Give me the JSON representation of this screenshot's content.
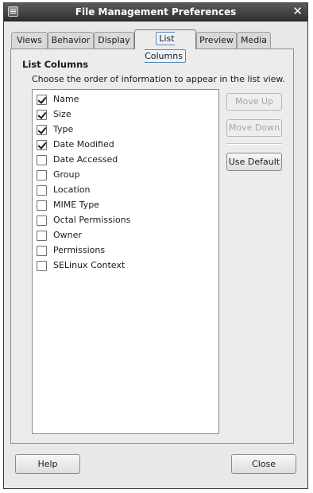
{
  "window": {
    "title": "File Management Preferences",
    "close_symbol": "✕"
  },
  "tabs": [
    {
      "label": "Views"
    },
    {
      "label": "Behavior"
    },
    {
      "label": "Display"
    },
    {
      "label": "List Columns",
      "active": true
    },
    {
      "label": "Preview"
    },
    {
      "label": "Media"
    }
  ],
  "section": {
    "title": "List Columns",
    "description": "Choose the order of information to appear in the list view."
  },
  "columns": [
    {
      "label": "Name",
      "checked": true
    },
    {
      "label": "Size",
      "checked": true
    },
    {
      "label": "Type",
      "checked": true
    },
    {
      "label": "Date Modified",
      "checked": true
    },
    {
      "label": "Date Accessed",
      "checked": false
    },
    {
      "label": "Group",
      "checked": false
    },
    {
      "label": "Location",
      "checked": false
    },
    {
      "label": "MIME Type",
      "checked": false
    },
    {
      "label": "Octal Permissions",
      "checked": false
    },
    {
      "label": "Owner",
      "checked": false
    },
    {
      "label": "Permissions",
      "checked": false
    },
    {
      "label": "SELinux Context",
      "checked": false
    }
  ],
  "side_buttons": {
    "move_up": "Move Up",
    "move_down": "Move Down",
    "use_default": "Use Default"
  },
  "footer": {
    "help": "Help",
    "close": "Close"
  },
  "colors": {
    "titlebar": "#3a3a3a",
    "window_bg": "#e8e8e8",
    "active_tab_focus": "#5d86b6"
  }
}
